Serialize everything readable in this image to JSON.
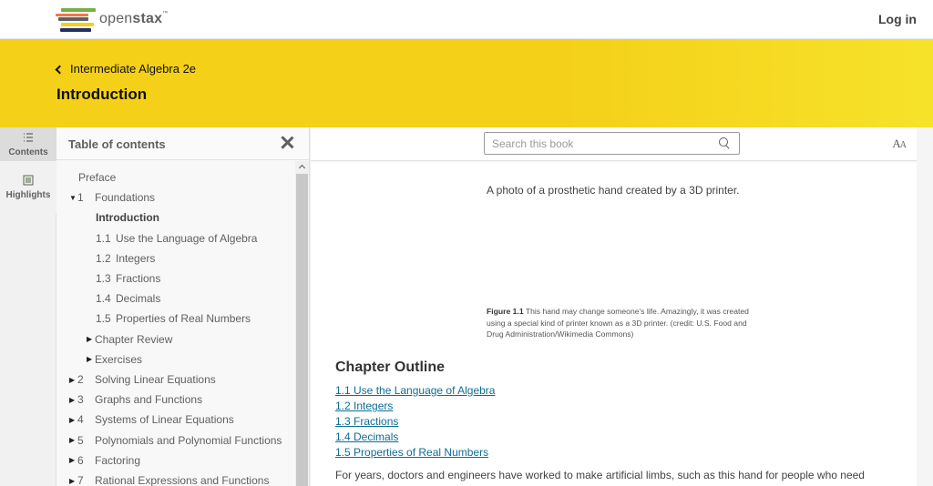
{
  "brand": {
    "logo_text": "openstax",
    "logo_prefix": "open",
    "logo_suffix": "stax",
    "trademark": "™",
    "logo_colors": [
      "#77af42",
      "#f47641",
      "#5e6062",
      "#f4d019",
      "#232e66"
    ]
  },
  "nav": {
    "login_label": "Log in"
  },
  "banner": {
    "book_title": "Intermediate Algebra 2e",
    "page_title": "Introduction",
    "color": "#f4d019"
  },
  "sidetools": {
    "contents_label": "Contents",
    "highlights_label": "Highlights"
  },
  "toc": {
    "title": "Table of contents",
    "items": [
      {
        "tri": "",
        "num": "",
        "label": "Preface",
        "bold": false
      },
      {
        "tri": "▼",
        "num": "1",
        "label": "Foundations",
        "bold": false
      },
      {
        "tri": "",
        "num": "",
        "label": "Introduction",
        "bold": true
      },
      {
        "tri": "",
        "num": "1.1",
        "label": "Use the Language of Algebra",
        "bold": false
      },
      {
        "tri": "",
        "num": "1.2",
        "label": "Integers",
        "bold": false
      },
      {
        "tri": "",
        "num": "1.3",
        "label": "Fractions",
        "bold": false
      },
      {
        "tri": "",
        "num": "1.4",
        "label": "Decimals",
        "bold": false
      },
      {
        "tri": "",
        "num": "1.5",
        "label": "Properties of Real Numbers",
        "bold": false
      },
      {
        "tri": "▶",
        "num": "",
        "label": "Chapter Review",
        "bold": false
      },
      {
        "tri": "▶",
        "num": "",
        "label": "Exercises",
        "bold": false
      },
      {
        "tri": "▶",
        "num": "2",
        "label": "Solving Linear Equations",
        "bold": false
      },
      {
        "tri": "▶",
        "num": "3",
        "label": "Graphs and Functions",
        "bold": false
      },
      {
        "tri": "▶",
        "num": "4",
        "label": "Systems of Linear Equations",
        "bold": false
      },
      {
        "tri": "▶",
        "num": "5",
        "label": "Polynomials and Polynomial Functions",
        "bold": false
      },
      {
        "tri": "▶",
        "num": "6",
        "label": "Factoring",
        "bold": false
      },
      {
        "tri": "▶",
        "num": "7",
        "label": "Rational Expressions and Functions",
        "bold": false
      }
    ]
  },
  "toolbar": {
    "search_placeholder": "Search this book",
    "search_value": "",
    "text_size_label": "AA"
  },
  "content": {
    "photo_alt_text": "A photo of a prosthetic hand created by a 3D printer.",
    "figure_label": "Figure 1.1",
    "figure_caption": " This hand may change someone's life. Amazingly, it was created using a special kind of printer known as a 3D printer. (credit: U.S. Food and Drug Administration/Wikimedia Commons)",
    "chapter_outline_heading": "Chapter Outline",
    "outline_links": [
      "1.1 Use the Language of Algebra",
      "1.2 Integers",
      "1.3 Fractions",
      "1.4 Decimals",
      "1.5 Properties of Real Numbers"
    ],
    "paragraph": "For years, doctors and engineers have worked to make artificial limbs, such as this hand for people who need"
  }
}
